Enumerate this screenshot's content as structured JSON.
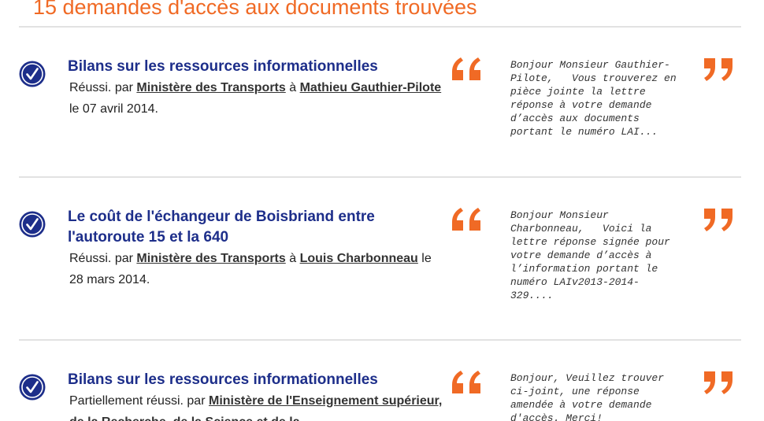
{
  "results_title": "15 demandes d'accès aux documents trouvées",
  "colors": {
    "accent": "#f06a25",
    "title_blue": "#1d2e8a",
    "check_blue": "#1d2e8a",
    "divider": "#e2e2e2"
  },
  "icons": {
    "status": "checkmark-circle-icon",
    "quote_open": "quote-open-icon",
    "quote_close": "quote-close-icon"
  },
  "results": [
    {
      "title": "Bilans sur les ressources informationnelles",
      "status": "Réussi.",
      "by_word": "par",
      "organization": "Ministère des Transports",
      "to_word": "à",
      "requester": "Mathieu Gauthier-Pilote",
      "date_text": "le 07 avril 2014.",
      "excerpt": "Bonjour Monsieur Gauthier-\nPilote,   Vous trouverez en\npièce jointe la lettre\nréponse à votre demande\nd’accès aux documents\nportant le numéro LAI..."
    },
    {
      "title": "Le coût de l'échangeur de Boisbriand entre l'autoroute 15 et la 640",
      "status": "Réussi.",
      "by_word": "par",
      "organization": "Ministère des Transports",
      "to_word": "à",
      "requester": "Louis Charbonneau",
      "date_text": "le 28 mars 2014.",
      "excerpt": "Bonjour Monsieur\nCharbonneau,   Voici la\nlettre réponse signée pour\nvotre demande d’accès à\nl’information portant le\nnuméro LAIv2013-2014-\n329...."
    },
    {
      "title": "Bilans sur les ressources informationnelles",
      "status": "Partiellement réussi.",
      "by_word": "par",
      "organization": "Ministère de l'Enseignement supérieur, de la Recherche, de la Science et de la",
      "to_word": "",
      "requester": "",
      "date_text": "",
      "excerpt": "Bonjour, Veuillez trouver\nci-joint, une réponse\namendée à votre demande\nd'accès. Merci!"
    }
  ]
}
